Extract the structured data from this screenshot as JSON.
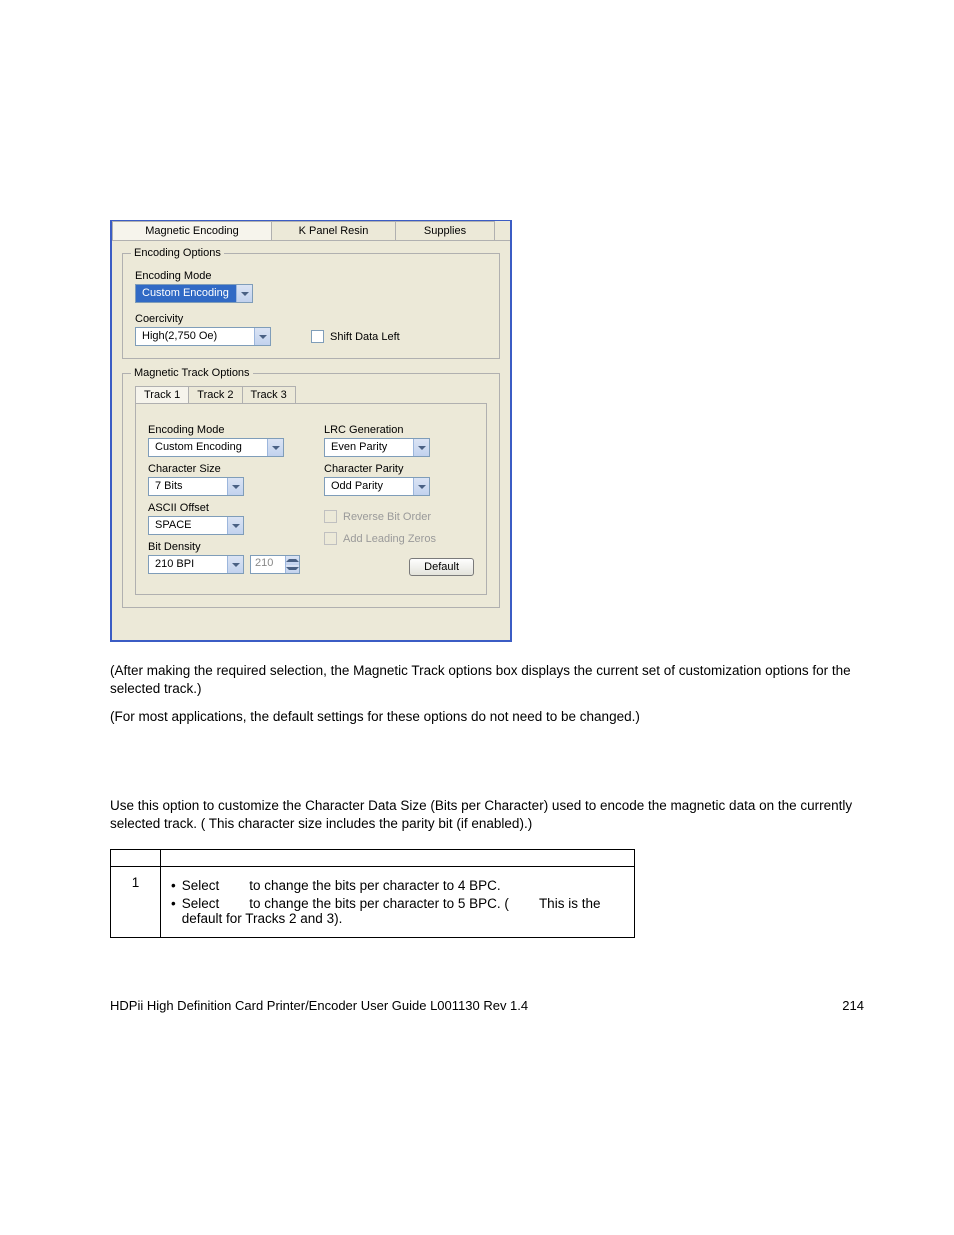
{
  "dialog": {
    "top_tabs": [
      "Magnetic Encoding",
      "K Panel Resin",
      "Supplies"
    ],
    "encoding_options": {
      "legend": "Encoding Options",
      "mode_label": "Encoding Mode",
      "mode_value": "Custom Encoding",
      "coercivity_label": "Coercivity",
      "coercivity_value": "High(2,750 Oe)",
      "shift_label": "Shift Data Left"
    },
    "track_options": {
      "legend": "Magnetic Track Options",
      "tabs": [
        "Track 1",
        "Track 2",
        "Track 3"
      ],
      "encoding_mode_label": "Encoding Mode",
      "encoding_mode_value": "Custom Encoding",
      "char_size_label": "Character Size",
      "char_size_value": "7 Bits",
      "ascii_offset_label": "ASCII Offset",
      "ascii_offset_value": "SPACE",
      "bit_density_label": "Bit Density",
      "bit_density_value": "210 BPI",
      "bit_density_spin": "210",
      "lrc_label": "LRC Generation",
      "lrc_value": "Even Parity",
      "char_parity_label": "Character Parity",
      "char_parity_value": "Odd Parity",
      "reverse_label": "Reverse Bit Order",
      "leading_label": "Add Leading Zeros",
      "default_btn": "Default"
    }
  },
  "notes": {
    "n1_pre": " (",
    "n1": "After making the required selection, the Magnetic Track options box displays the current set of customization options for the selected track.)",
    "n2_pre": "(",
    "n2": "For most applications, the default settings for these options do not need to be changed.)"
  },
  "section_intro": "Use this option to customize the Character Data Size (Bits per Character) used to encode the magnetic data on the currently selected track. (          This character size includes the parity bit (if enabled).)",
  "table": {
    "step": "1",
    "b1a": "Select",
    "b1b": "to change the bits per character to 4 BPC.",
    "b2a": "Select",
    "b2b": "to change the bits per character to 5 BPC. (",
    "b2c": "This is the default for Tracks 2 and 3)."
  },
  "footer": {
    "left": "HDPii High Definition Card Printer/Encoder User Guide    L001130 Rev 1.4",
    "page": "214"
  }
}
